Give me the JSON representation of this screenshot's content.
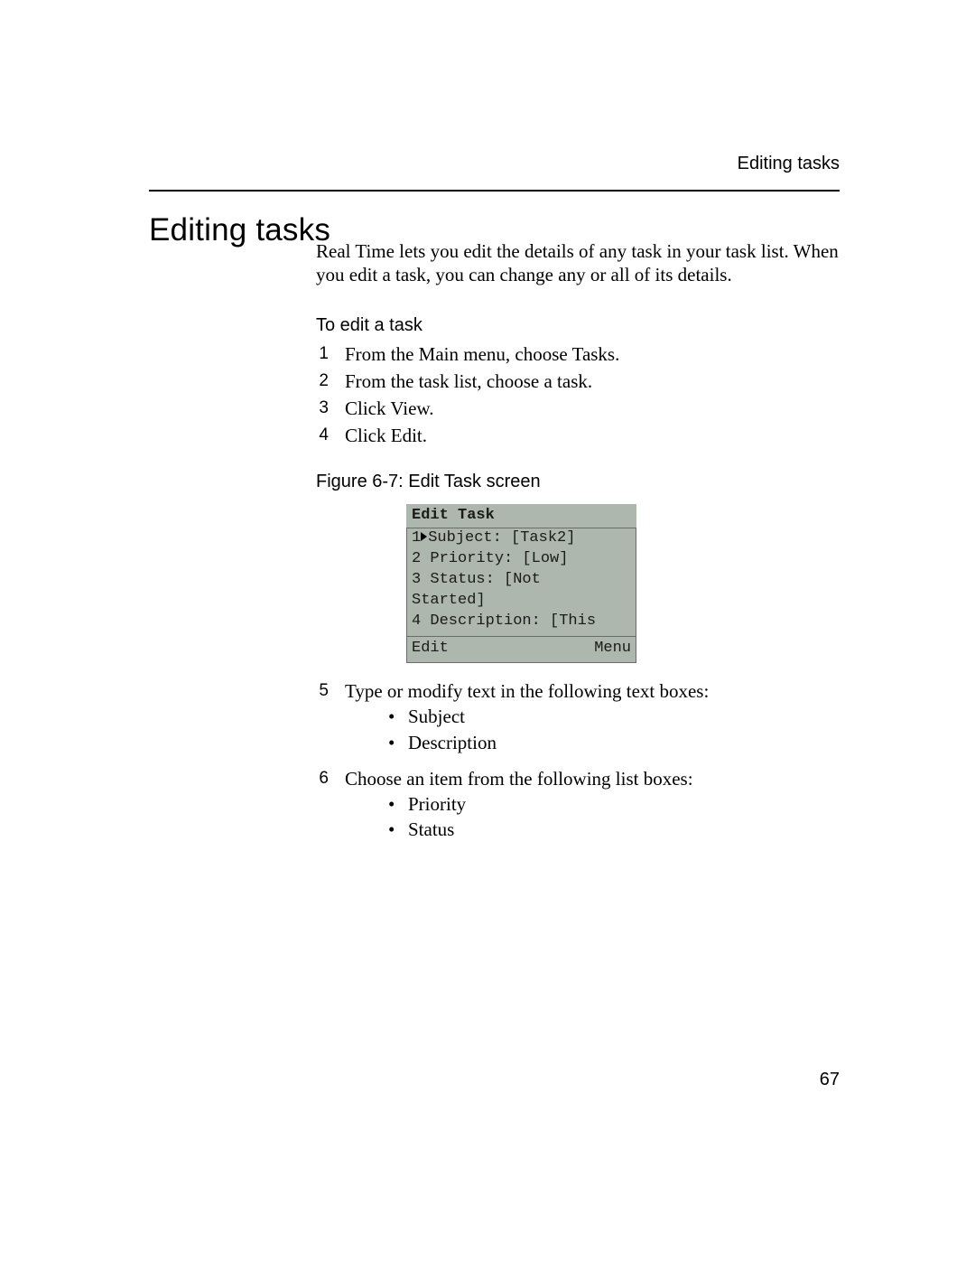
{
  "header": {
    "running": "Editing tasks"
  },
  "title": "Editing tasks",
  "intro": "Real Time lets you edit the details of any task in your task list. When you edit a task, you can change any or all of its details.",
  "procedure": {
    "heading": "To edit a task",
    "steps_a": [
      {
        "n": "1",
        "t": "From the Main menu, choose Tasks."
      },
      {
        "n": "2",
        "t": "From the task list, choose a task."
      },
      {
        "n": "3",
        "t": "Click View."
      },
      {
        "n": "4",
        "t": "Click Edit."
      }
    ],
    "steps_b": [
      {
        "n": "5",
        "t": "Type or modify text in the following text boxes:",
        "bullets": [
          "Subject",
          "Description"
        ]
      },
      {
        "n": "6",
        "t": "Choose an item from the following list boxes:",
        "bullets": [
          "Priority",
          "Status"
        ]
      }
    ]
  },
  "figure": {
    "caption": "Figure 6-7: Edit Task screen",
    "screen": {
      "title": "Edit Task",
      "lines": [
        {
          "prefix": "1",
          "pointer": true,
          "text": "Subject: [Task2]"
        },
        {
          "prefix": "2",
          "pointer": false,
          "text": " Priority: [Low]"
        },
        {
          "prefix": "3",
          "pointer": false,
          "text": " Status: [Not"
        },
        {
          "prefix": "",
          "pointer": false,
          "text": "Started]"
        },
        {
          "prefix": "4",
          "pointer": false,
          "text": " Description: [This"
        }
      ],
      "footer_left": "Edit",
      "footer_right": "Menu"
    }
  },
  "page_number": "67"
}
